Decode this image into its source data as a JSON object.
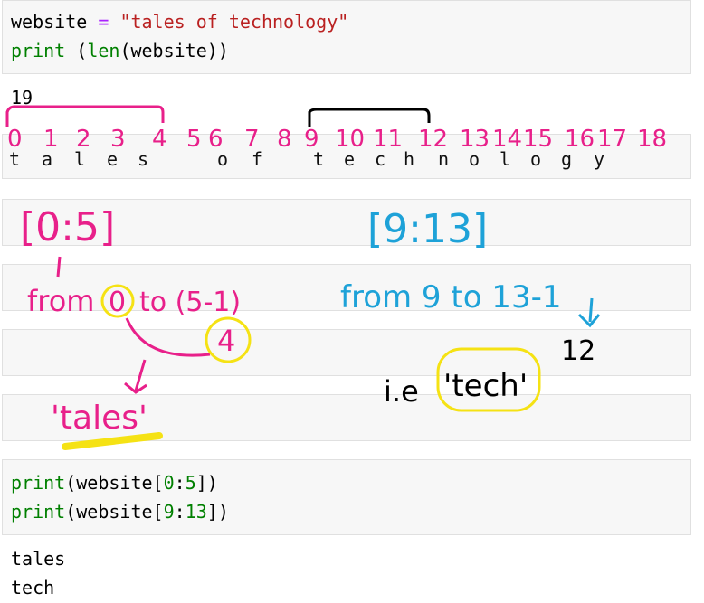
{
  "cell1": {
    "line1": {
      "var": "website",
      "op": "=",
      "str": "\"tales of technology\""
    },
    "line2": {
      "fn": "print",
      "rest1": " (",
      "fn2": "len",
      "rest2": "(website))"
    }
  },
  "out1": {
    "value": "19"
  },
  "letters": [
    "t",
    "a",
    "l",
    "e",
    "s",
    " ",
    "o",
    "f",
    " ",
    "t",
    "e",
    "c",
    "h",
    "n",
    "o",
    "l",
    "o",
    "g",
    "y"
  ],
  "index_labels": [
    "0",
    "1",
    "2",
    "3",
    "4",
    "5",
    "6",
    "7",
    "8",
    "9",
    "10",
    "11",
    "12",
    "13",
    "14",
    "15",
    "16",
    "17",
    "18"
  ],
  "annotations": {
    "left_slice": "[0:5]",
    "left_from": "from",
    "left_zero": "0",
    "left_to": "to (5-1)",
    "left_four": "4",
    "left_result": "'tales'",
    "right_slice": "[9:13]",
    "right_from": "from 9 to 13-1",
    "right_twelve": "12",
    "right_ie": "i.e",
    "right_result": "'tech'"
  },
  "cell2": {
    "line1": {
      "fn": "print",
      "a": "(website[",
      "n1": "0",
      "b": ":",
      "n2": "5",
      "c": "])"
    },
    "line2": {
      "fn": "print",
      "a": "(website[",
      "n1": "9",
      "b": ":",
      "n2": "13",
      "c": "])"
    }
  },
  "out2": [
    "tales",
    "tech"
  ],
  "colors": {
    "magenta": "#e8208a",
    "blue": "#1ea2d8",
    "yellow": "#f5e214",
    "ink": "#000000"
  }
}
